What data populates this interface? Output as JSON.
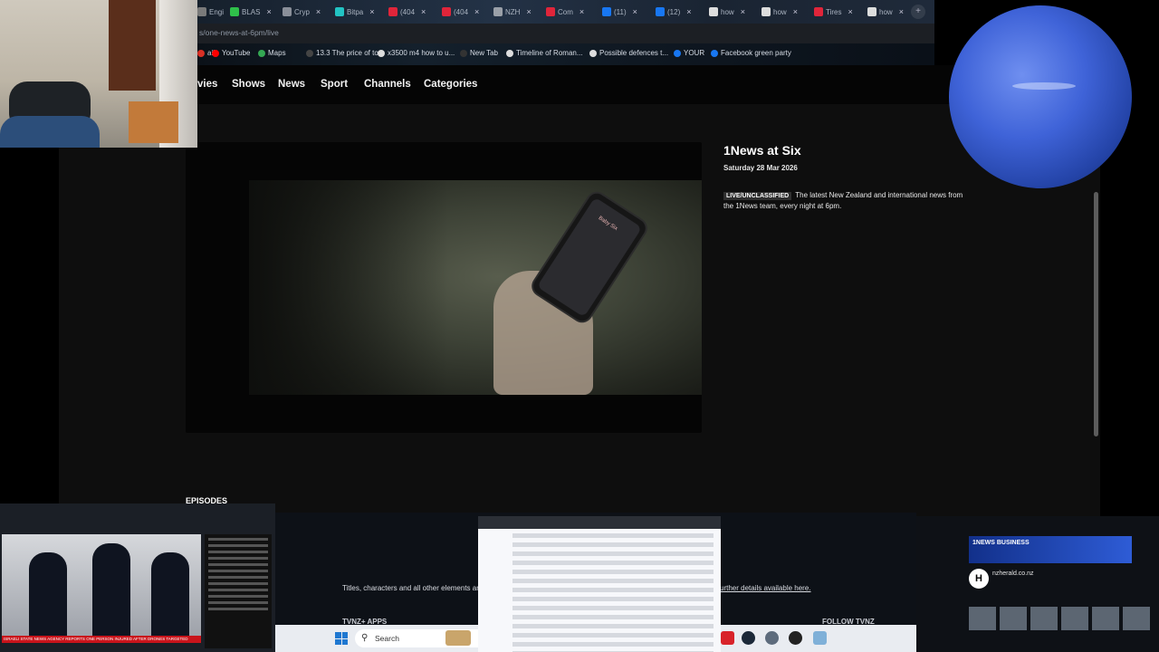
{
  "browser": {
    "tabs": [
      {
        "label": "Engi",
        "color": "#7a7a7a"
      },
      {
        "label": "BLAS",
        "color": "#2fbf4a"
      },
      {
        "label": "Cryp",
        "color": "#8a8f99"
      },
      {
        "label": "Bitpa",
        "color": "#22c3c3"
      },
      {
        "label": "(404",
        "color": "#e0253a"
      },
      {
        "label": "(404",
        "color": "#e0253a"
      },
      {
        "label": "NZH",
        "color": "#9aa0a8"
      },
      {
        "label": "Com",
        "color": "#e0253a"
      },
      {
        "label": "(11)",
        "color": "#1877f2"
      },
      {
        "label": "(12)",
        "color": "#1877f2"
      },
      {
        "label": "how",
        "color": "#dddddd"
      },
      {
        "label": "how",
        "color": "#dddddd"
      },
      {
        "label": "Tires",
        "color": "#e0253a"
      },
      {
        "label": "how",
        "color": "#dddddd"
      }
    ],
    "url": "s/one-news-at-6pm/live",
    "bookmarks": [
      {
        "label": "ail",
        "color": "#d93025"
      },
      {
        "label": "YouTube",
        "color": "#ff0000"
      },
      {
        "label": "Maps",
        "color": "#34a853"
      },
      {
        "label": "13.3 The price of to...",
        "color": "#444444"
      },
      {
        "label": "x3500 m4 how to u...",
        "color": "#dddddd"
      },
      {
        "label": "New Tab",
        "color": "#333333"
      },
      {
        "label": "Timeline of Roman...",
        "color": "#dddddd"
      },
      {
        "label": "Possible defences t...",
        "color": "#dddddd"
      },
      {
        "label": "YOUR",
        "color": "#1877f2"
      },
      {
        "label": "Facebook green party",
        "color": "#1877f2"
      }
    ]
  },
  "nav": {
    "items": [
      "vies",
      "Shows",
      "News",
      "Sport",
      "Channels",
      "Categories"
    ]
  },
  "video": {
    "phone_label": "Baby Six"
  },
  "show": {
    "title": "1News at Six",
    "date": "Saturday 28 Mar 2026",
    "badge": "LIVE/UNCLASSIFIED",
    "description": "The latest New Zealand and international news from the 1News team, every night at 6pm."
  },
  "episodes_heading": "EPISODES",
  "footer": {
    "notice": "Titles, characters and all other elements are",
    "link": "urther details available here.",
    "apps_heading": "TVNZ+ APPS",
    "follow_heading": "FOLLOW TVNZ"
  },
  "taskbar": {
    "search_placeholder": "Search"
  },
  "thumbnails": {
    "news_ticker": "ISRAELI STATE NEWS AGENCY REPORTS ONE PERSON INJURED AFTER DRONES TARGETED",
    "nzh_banner": "1NEWS BUSINESS",
    "nzh_site": "nzherald.co.nz",
    "nzh_logo": "H"
  }
}
